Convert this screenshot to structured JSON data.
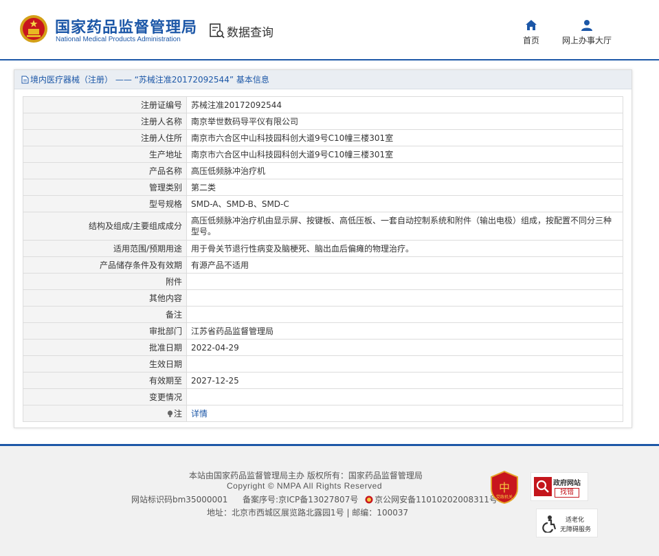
{
  "header": {
    "logo_cn": "国家药品监督管理局",
    "logo_en": "National Medical Products Administration",
    "section_title": "数据查询",
    "nav": [
      {
        "label": "首页",
        "icon": "home-icon"
      },
      {
        "label": "网上办事大厅",
        "icon": "user-icon"
      }
    ]
  },
  "panel": {
    "title": "境内医疗器械（注册） —— “苏械注准20172092544” 基本信息",
    "rows": [
      {
        "label": "注册证编号",
        "value": "苏械注准20172092544"
      },
      {
        "label": "注册人名称",
        "value": "南京举世数码导平仪有限公司"
      },
      {
        "label": "注册人住所",
        "value": "南京市六合区中山科技园科创大道9号C10幢三楼301室"
      },
      {
        "label": "生产地址",
        "value": "南京市六合区中山科技园科创大道9号C10幢三楼301室"
      },
      {
        "label": "产品名称",
        "value": "高压低频脉冲治疗机"
      },
      {
        "label": "管理类别",
        "value": "第二类"
      },
      {
        "label": "型号规格",
        "value": "SMD-A、SMD-B、SMD-C"
      },
      {
        "label": "结构及组成/主要组成成分",
        "value": "高压低频脉冲治疗机由显示屏、按键板、高低压板、一套自动控制系统和附件（输出电极）组成，按配置不同分三种型号。"
      },
      {
        "label": "适用范围/预期用途",
        "value": "用于骨关节退行性病变及脑梗死、脑出血后偏瘫的物理治疗。"
      },
      {
        "label": "产品储存条件及有效期",
        "value": "有源产品不适用"
      },
      {
        "label": "附件",
        "value": ""
      },
      {
        "label": "其他内容",
        "value": ""
      },
      {
        "label": "备注",
        "value": ""
      },
      {
        "label": "审批部门",
        "value": "江苏省药品监督管理局"
      },
      {
        "label": "批准日期",
        "value": "2022-04-29"
      },
      {
        "label": "生效日期",
        "value": ""
      },
      {
        "label": "有效期至",
        "value": "2027-12-25"
      },
      {
        "label": "变更情况",
        "value": ""
      }
    ],
    "note_label": "注",
    "note_link": "详情"
  },
  "footer": {
    "line1": "本站由国家药品监督管理局主办 版权所有：国家药品监督管理局",
    "line2": "Copyright © NMPA All Rights Reserved",
    "line3a": "网站标识码bm35000001",
    "line3b": "备案序号:京ICP备13027807号",
    "line3c": "京公网安备11010202008311号",
    "line4": "地址：北京市西城区展览路北露园1号 | 邮编：100037",
    "badge_red_text": "党政机关",
    "badge_gov_title": "政府网站",
    "badge_gov_action": "找错",
    "badge_aged_line1": "适老化",
    "badge_aged_line2": "无障碍服务"
  },
  "colors": {
    "brand": "#1c57a7",
    "label_bg": "#f4f4f4",
    "title_bar_bg": "#eaeef3",
    "footer_bg": "#f1f1f1"
  }
}
